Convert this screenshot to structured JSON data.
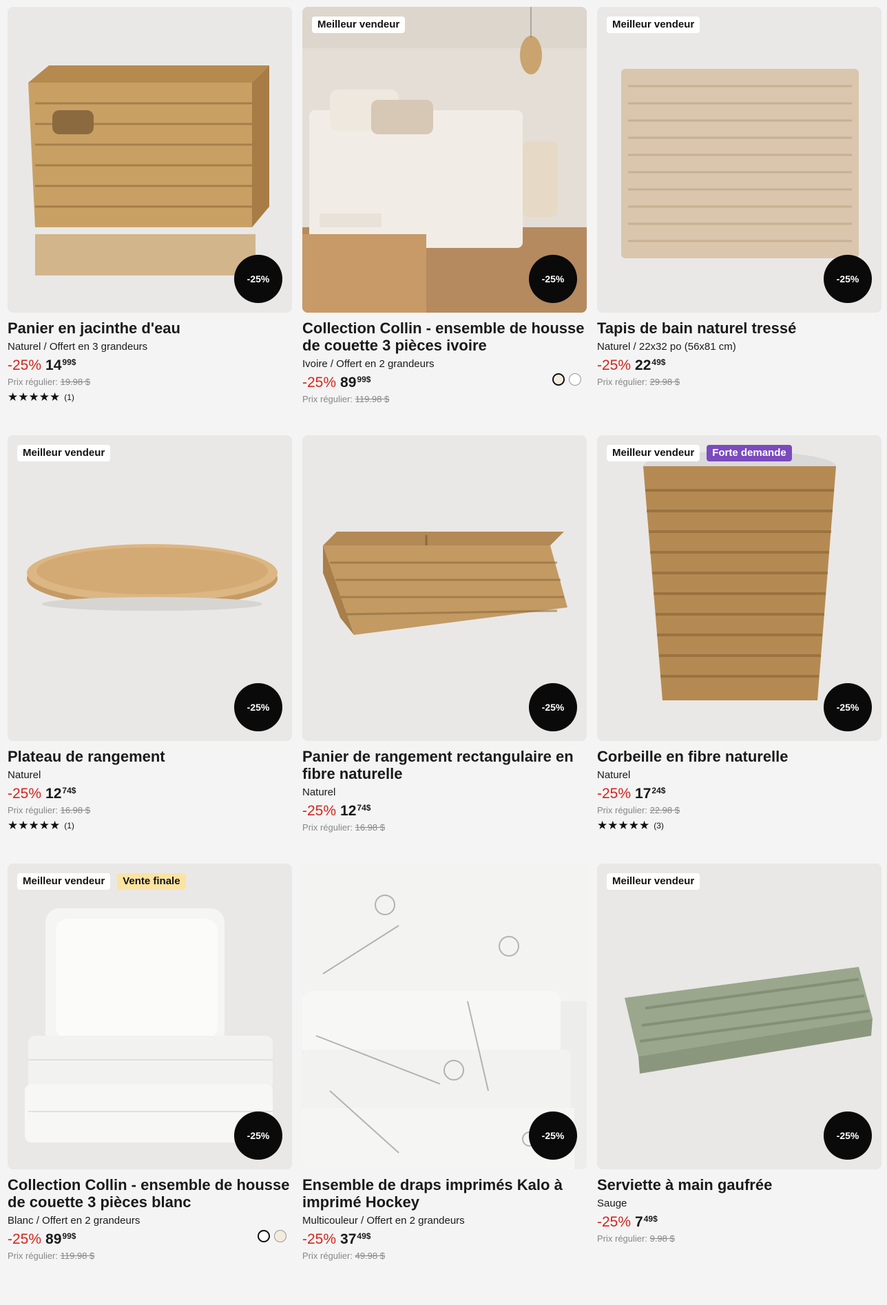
{
  "products": [
    {
      "title": "Panier en jacinthe d'eau",
      "variant": "Naturel / Offert en 3 grandeurs",
      "badges": [],
      "discount_badge": "-25%",
      "discount_text": "-25%",
      "price_main": "14",
      "price_sup": "99$",
      "regular_label": "Prix régulier:",
      "regular_price": "19.98 $",
      "rating": 5,
      "stars": "★★★★★",
      "review_count": "(1)",
      "swatches": [],
      "image_icon": "basket-image"
    },
    {
      "title": "Collection Collin - ensemble de housse de couette 3 pièces ivoire",
      "variant": "Ivoire / Offert en 2 grandeurs",
      "badges": [
        {
          "label": "Meilleur vendeur",
          "kind": "plain"
        }
      ],
      "discount_badge": "-25%",
      "discount_text": "-25%",
      "price_main": "89",
      "price_sup": "99$",
      "regular_label": "Prix régulier:",
      "regular_price": "119.98 $",
      "rating": null,
      "stars": "",
      "review_count": "",
      "swatches": [
        "#f3ecdc",
        "#ffffff"
      ],
      "image_icon": "bedroom-image"
    },
    {
      "title": "Tapis de bain naturel tressé",
      "variant": "Naturel / 22x32 po (56x81 cm)",
      "badges": [
        {
          "label": "Meilleur vendeur",
          "kind": "plain"
        }
      ],
      "discount_badge": "-25%",
      "discount_text": "-25%",
      "price_main": "22",
      "price_sup": "49$",
      "regular_label": "Prix régulier:",
      "regular_price": "29.98 $",
      "rating": null,
      "stars": "",
      "review_count": "",
      "swatches": [],
      "image_icon": "bathmat-image"
    },
    {
      "title": "Plateau de rangement",
      "variant": "Naturel",
      "badges": [
        {
          "label": "Meilleur vendeur",
          "kind": "plain"
        }
      ],
      "discount_badge": "-25%",
      "discount_text": "-25%",
      "price_main": "12",
      "price_sup": "74$",
      "regular_label": "Prix régulier:",
      "regular_price": "16.98 $",
      "rating": 5,
      "stars": "★★★★★",
      "review_count": "(1)",
      "swatches": [],
      "image_icon": "tray-image"
    },
    {
      "title": "Panier de rangement rectangulaire en fibre naturelle",
      "variant": "Naturel",
      "badges": [],
      "discount_badge": "-25%",
      "discount_text": "-25%",
      "price_main": "12",
      "price_sup": "74$",
      "regular_label": "Prix régulier:",
      "regular_price": "16.98 $",
      "rating": null,
      "stars": "",
      "review_count": "",
      "swatches": [],
      "image_icon": "rect-basket-image"
    },
    {
      "title": "Corbeille en fibre naturelle",
      "variant": "Naturel",
      "badges": [
        {
          "label": "Meilleur vendeur",
          "kind": "plain"
        },
        {
          "label": "Forte demande",
          "kind": "demand"
        }
      ],
      "discount_badge": "-25%",
      "discount_text": "-25%",
      "price_main": "17",
      "price_sup": "24$",
      "regular_label": "Prix régulier:",
      "regular_price": "22.98 $",
      "rating": 4.5,
      "stars": "★★★★★",
      "review_count": "(3)",
      "swatches": [],
      "image_icon": "wastebasket-image"
    },
    {
      "title": "Collection Collin - ensemble de housse de couette 3 pièces blanc",
      "variant": "Blanc / Offert en 2 grandeurs",
      "badges": [
        {
          "label": "Meilleur vendeur",
          "kind": "plain"
        },
        {
          "label": "Vente finale",
          "kind": "final"
        }
      ],
      "discount_badge": "-25%",
      "discount_text": "-25%",
      "price_main": "89",
      "price_sup": "99$",
      "regular_label": "Prix régulier:",
      "regular_price": "119.98 $",
      "rating": null,
      "stars": "",
      "review_count": "",
      "swatches": [
        "#ffffff",
        "#f3ecdc"
      ],
      "image_icon": "duvet-image"
    },
    {
      "title": "Ensemble de draps imprimés Kalo à imprimé Hockey",
      "variant": "Multicouleur / Offert en 2 grandeurs",
      "badges": [],
      "discount_badge": "-25%",
      "discount_text": "-25%",
      "price_main": "37",
      "price_sup": "49$",
      "regular_label": "Prix régulier:",
      "regular_price": "49.98 $",
      "rating": null,
      "stars": "",
      "review_count": "",
      "swatches": [],
      "image_icon": "sheets-image"
    },
    {
      "title": "Serviette à main gaufrée",
      "variant": "Sauge",
      "badges": [
        {
          "label": "Meilleur vendeur",
          "kind": "plain"
        }
      ],
      "discount_badge": "-25%",
      "discount_text": "-25%",
      "price_main": "7",
      "price_sup": "49$",
      "regular_label": "Prix régulier:",
      "regular_price": "9.98 $",
      "rating": null,
      "stars": "",
      "review_count": "",
      "swatches": [],
      "image_icon": "towel-image"
    }
  ],
  "colors": {
    "page_bg": "#f4f4f4",
    "card_bg": "#e9e8e6",
    "discount": "#d4251c",
    "badge_demand": "#7b4bbd",
    "badge_final": "#fbe3a3"
  }
}
